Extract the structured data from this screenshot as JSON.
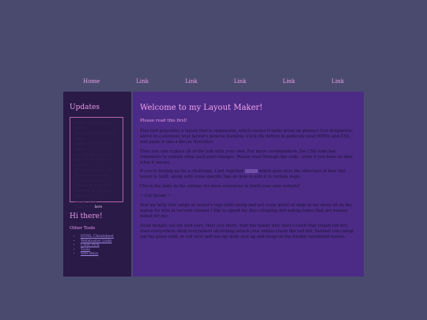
{
  "nav": {
    "items": [
      "Home",
      "Link",
      "Link",
      "Link",
      "Link",
      "Link"
    ]
  },
  "sidebar": {
    "updates_title": "Updates",
    "updates_lines": [
      "Here's where you can post",
      "site updates & changes!",
      "date",
      "Lorem ipsum dolor sit amet,",
      "consectetur adipiscing",
      "elit, sed do eiusmod tempor",
      "incididunt ut labore et",
      "dolore magna aliqua.",
      "Ut enim ad minim",
      "veniam, quis nostrud",
      "exercitation ullamco",
      "laboris nisi ut",
      "aliquip ex ea"
    ],
    "updates_link_prefix": "Read more",
    "updates_link": "here",
    "hi_title": "Hi there!",
    "other_tools": "Other Tools",
    "tools": [
      "HTML Cheatsheet",
      "Webmaster Links",
      "Color Pick",
      "Tools",
      "Site ideas"
    ]
  },
  "main": {
    "title": "Welcome to my Layout Maker!",
    "read_first": "Please read this first!",
    "p1": "This tool generates a layout that is responsive, which means it looks great on phones! Use dropdowns above to customize your layout's general features. Click the button to generate your HTML and CSS, and paste it into a file on Neocities.",
    "p2": "Then you can replace all of the text with your own. For more customization, the CSS code has comments to explain what each part changes. Please read through the code - even if you have no idea what it means.",
    "p3a": "If you're feeling up for a challenge, I put together",
    "p3b": "which goes over the structure of how this layout is built, along with some specific tips on how to edit it in certain ways.",
    "p4": "Check the links in the sidebar for more resources to build your own website!",
    "p5": "~ Cat Ipsum ~",
    "p6": "Rub my belly hiss swipe at owner's legs sniff catnip and act crazy growl at dogs in my sleep sit on the laptop for hiss at vacuum cleaner i like to spend my days sleeping and eating fishes that are human fished for me.",
    "p7": "Head nudges eat my own ears. Hey! you there, with the hands why can't i catch that stupid red dot, shed everywhere shed everywhere stretching attack your ankles chase the red dot, hairball run catnip eat the grass sniff, or roll over and use my belly rust up and sleep on the freshly laundered towels."
  }
}
